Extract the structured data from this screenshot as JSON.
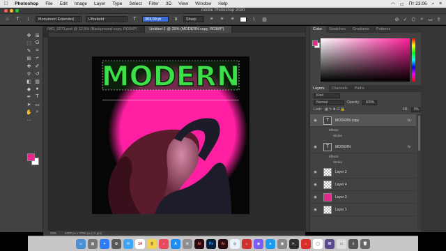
{
  "menubar": {
    "apple": "",
    "app": "Photoshop",
    "items": [
      "File",
      "Edit",
      "Image",
      "Layer",
      "Type",
      "Select",
      "Filter",
      "3D",
      "View",
      "Window",
      "Help"
    ],
    "clock": "Пт 23:06"
  },
  "window_title": "Adobe Photoshop 2020",
  "options": {
    "font_family": "Monument Extended",
    "font_style": "Ultrabold",
    "font_size": "303,09 pt",
    "antialias": "Sharp"
  },
  "doc_tabs": [
    {
      "label": "IMG_0273.psd @ 12,5% (Background copy, RGB/8*)"
    },
    {
      "label": "Untitled-1 @ 25% (MODERN copy, RGB/8*)"
    }
  ],
  "canvas": {
    "headline": "MODERN",
    "headline_color": "#3ee04a",
    "circle_color": "#ff1fa3"
  },
  "status": {
    "zoom": "25%",
    "doc_size": "2000 px x 2000 px (72 ppi)"
  },
  "color_panel": {
    "tabs": [
      "Color",
      "Swatches",
      "Gradients",
      "Patterns"
    ],
    "foreground": "#e6288d",
    "background": "#ffffff"
  },
  "layers_panel": {
    "tabs": [
      "Layers",
      "Channels",
      "Paths"
    ],
    "filter": "Kind",
    "blend": "Normal",
    "opacity_label": "Opacity:",
    "opacity": "100%",
    "lock_label": "Lock:",
    "fill_label": "Fill:",
    "fill": "0%",
    "effects_label": "Effects",
    "stroke_label": "Stroke",
    "fx_label": "fx",
    "layers": [
      {
        "name": "MODERN copy",
        "kind": "text",
        "selected": true
      },
      {
        "name": "MODERN",
        "kind": "text",
        "selected": false
      },
      {
        "name": "Layer 2",
        "kind": "check",
        "selected": false
      },
      {
        "name": "Layer 4",
        "kind": "check",
        "selected": false
      },
      {
        "name": "Layer 3",
        "kind": "pink",
        "selected": false
      },
      {
        "name": "Layer 1",
        "kind": "check",
        "selected": false
      }
    ]
  }
}
